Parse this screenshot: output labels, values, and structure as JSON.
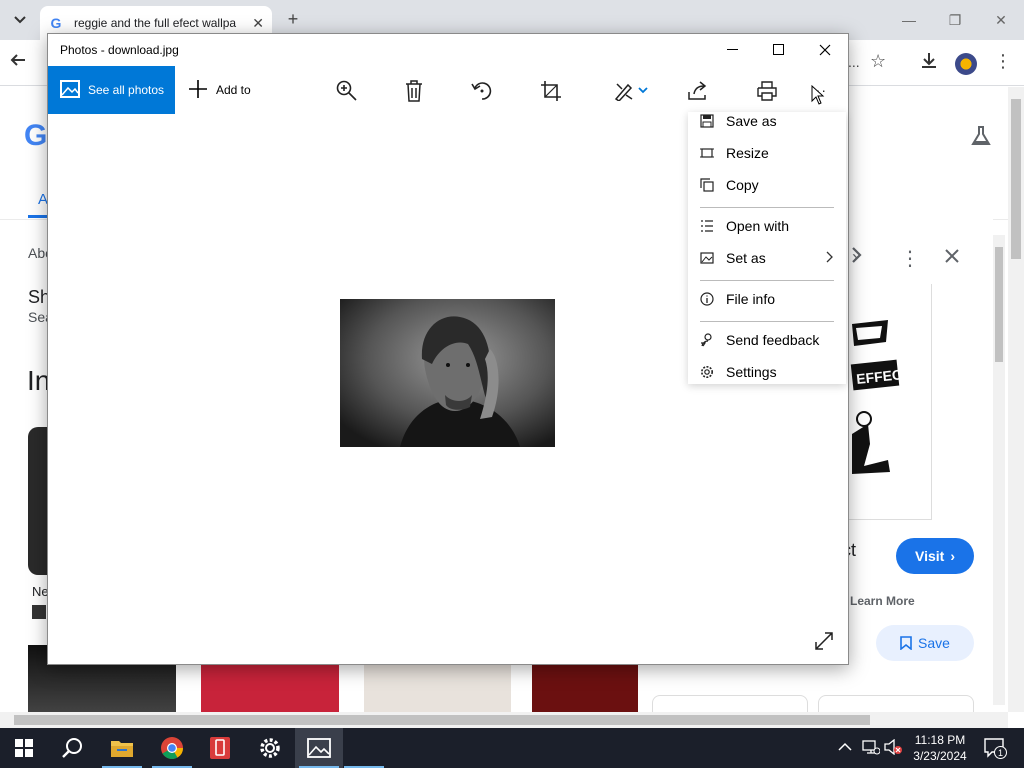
{
  "browser": {
    "tab_title": "reggie and the full efect wallpa",
    "tab_close": "✕",
    "new_tab": "+",
    "min": "—",
    "restore": "❐",
    "close": "✕",
    "omnibox_tail": "..."
  },
  "page": {
    "logo": "G",
    "tab_first_letter": "A",
    "about_text": "Abo",
    "share_text": "Sh",
    "search_text": "Sea",
    "heading": "In",
    "item_text": "Ne"
  },
  "side_panel": {
    "title_tail": "ct",
    "visit_label": "Visit",
    "learn_more_label": "Learn More",
    "save_label": "Save"
  },
  "photos": {
    "title": "Photos - download.jpg",
    "see_all_label": "See all photos",
    "add_to_label": "Add to",
    "more_label": "···"
  },
  "menu": {
    "items": [
      {
        "label": "Save as",
        "icon": "save-icon"
      },
      {
        "label": "Resize",
        "icon": "resize-icon"
      },
      {
        "label": "Copy",
        "icon": "copy-icon"
      },
      {
        "label": "Open with",
        "icon": "open-with-icon"
      },
      {
        "label": "Set as",
        "icon": "set-as-icon"
      },
      {
        "label": "File info",
        "icon": "info-icon"
      },
      {
        "label": "Send feedback",
        "icon": "feedback-icon"
      },
      {
        "label": "Settings",
        "icon": "gear-icon"
      }
    ]
  },
  "taskbar": {
    "time": "11:18 PM",
    "date": "3/23/2024",
    "notifications": "1"
  },
  "colors": {
    "accent": "#0078d7",
    "chrome_tabbar": "#dee1e6",
    "taskbar": "#1b1f2a",
    "visit_button": "#1a73e8"
  }
}
